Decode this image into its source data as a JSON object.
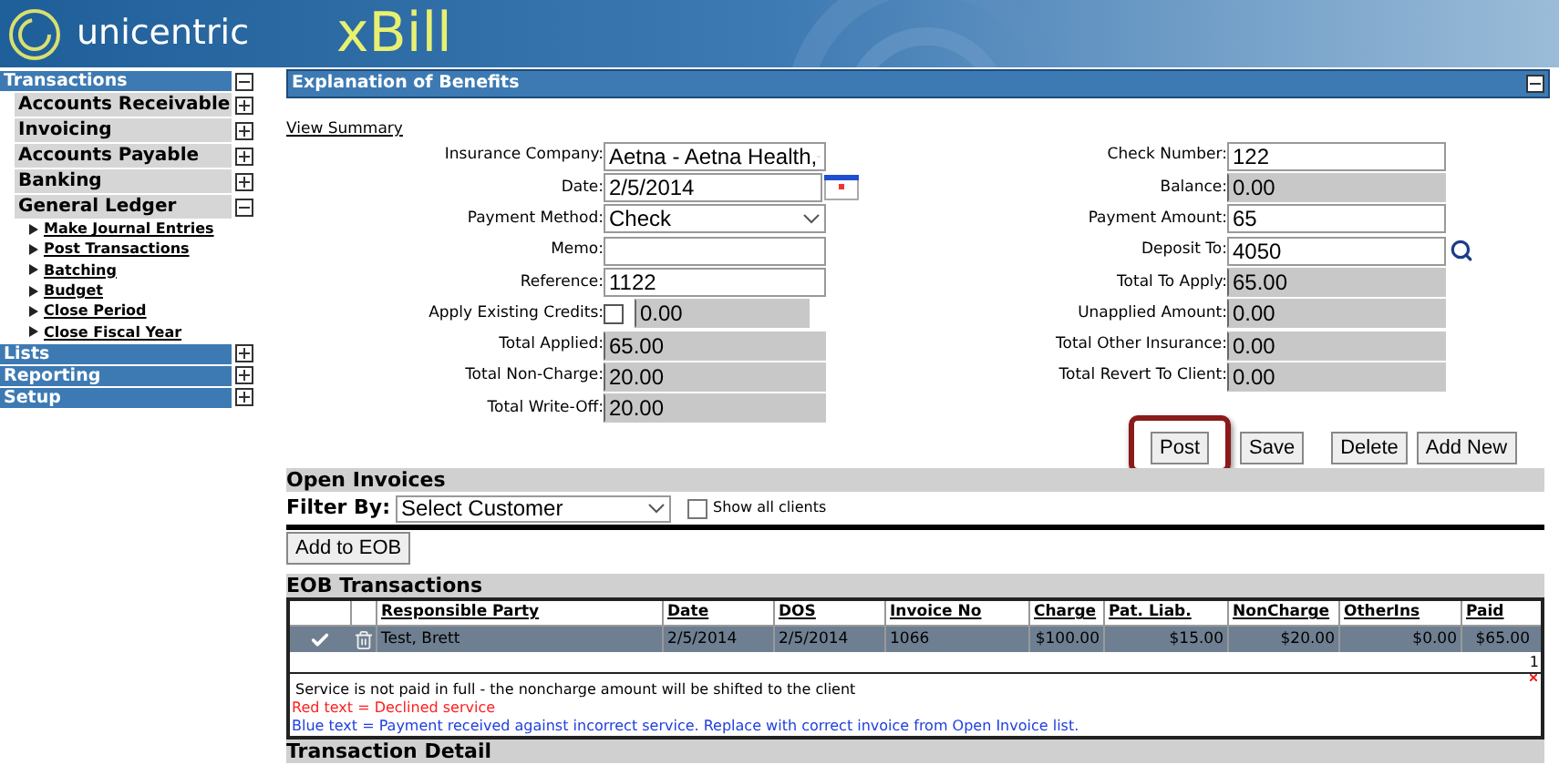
{
  "header": {
    "logo_text": "unicentric",
    "app_name": "xBill"
  },
  "sidebar": [
    {
      "label": "Transactions",
      "expanded": true,
      "children": [
        {
          "label": "Accounts Receivable",
          "expanded": false
        },
        {
          "label": "Invoicing",
          "expanded": false
        },
        {
          "label": "Accounts Payable",
          "expanded": false
        },
        {
          "label": "Banking",
          "expanded": false
        },
        {
          "label": "General Ledger",
          "expanded": true,
          "children": [
            {
              "label": "Make Journal Entries"
            },
            {
              "label": "Post Transactions"
            },
            {
              "label": "Batching"
            },
            {
              "label": "Budget"
            },
            {
              "label": "Close Period"
            },
            {
              "label": "Close Fiscal Year"
            }
          ]
        }
      ]
    },
    {
      "label": "Lists",
      "expanded": false
    },
    {
      "label": "Reporting",
      "expanded": false
    },
    {
      "label": "Setup",
      "expanded": false
    }
  ],
  "eob": {
    "title": "Explanation of Benefits",
    "view_summary": "View Summary",
    "left_fields": [
      {
        "label": "Insurance Company:",
        "kind": "select",
        "value": "Aetna - Aetna Health,"
      },
      {
        "label": "Date:",
        "kind": "date",
        "value": "2/5/2014"
      },
      {
        "label": "Payment Method:",
        "kind": "select",
        "value": "Check"
      },
      {
        "label": "Memo:",
        "kind": "text"
      },
      {
        "label": "Reference:",
        "kind": "text",
        "value": "1122"
      },
      {
        "label": "Apply Existing Credits:",
        "kind": "checkbox",
        "checked": false,
        "value": "0.00"
      },
      {
        "label": "Total Applied:",
        "kind": "readonly",
        "value": "65.00"
      },
      {
        "label": "Total Non-Charge:",
        "kind": "readonly",
        "value": "20.00"
      },
      {
        "label": "Total Write-Off:",
        "kind": "readonly",
        "value": "20.00"
      }
    ],
    "right_fields": [
      {
        "label": "Check Number:",
        "kind": "text",
        "value": "122"
      },
      {
        "label": "Balance:",
        "kind": "readonly",
        "value": "0.00"
      },
      {
        "label": "Payment Amount:",
        "kind": "text",
        "value": "65"
      },
      {
        "label": "Deposit To:",
        "kind": "lookup",
        "value": "4050"
      },
      {
        "label": "Total To Apply:",
        "kind": "readonly",
        "value": "65.00"
      },
      {
        "label": "Unapplied Amount:",
        "kind": "readonly",
        "value": "0.00"
      },
      {
        "label": "Total Other Insurance:",
        "kind": "readonly",
        "value": "0.00"
      },
      {
        "label": "Total Revert To Client:",
        "kind": "readonly",
        "value": "0.00"
      }
    ],
    "buttons": [
      {
        "label": "Post",
        "highlighted": true
      },
      {
        "label": "Save",
        "highlighted": false
      },
      {
        "label": "Delete",
        "highlighted": false
      },
      {
        "label": "Add New",
        "highlighted": false
      }
    ]
  },
  "open_invoices": {
    "title": "Open Invoices",
    "filter_label": "Filter By:",
    "filter_value": "Select Customer",
    "show_all_label": "Show all clients",
    "show_all_checked": false,
    "add_button": "Add to EOB"
  },
  "eob_transactions": {
    "title": "EOB Transactions",
    "columns": [
      "Responsible Party",
      "Date",
      "DOS",
      "Invoice No",
      "Charge",
      "Pat. Liab.",
      "NonCharge",
      "OtherIns",
      "Paid"
    ],
    "rows": [
      {
        "cells": [
          "Test, Brett",
          "2/5/2014",
          "2/5/2014",
          "1066",
          "$100.00",
          "$15.00",
          "$20.00",
          "$0.00",
          "$65.00"
        ]
      }
    ],
    "page": "1",
    "notes": [
      {
        "kind": "note",
        "text": "Service is not paid in full - the noncharge amount will be shifted to the client"
      },
      {
        "kind": "red",
        "text": "Red text = Declined service"
      },
      {
        "kind": "blue",
        "text": "Blue text = Payment received against incorrect service. Replace with correct invoice from Open Invoice list."
      }
    ]
  },
  "transaction_detail": {
    "title": "Transaction Detail"
  }
}
